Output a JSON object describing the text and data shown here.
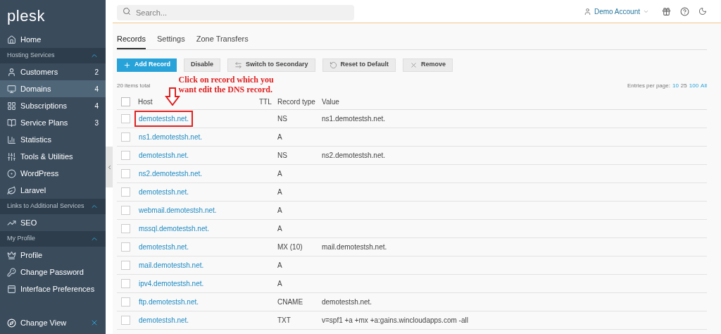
{
  "logo": "plesk",
  "sidebar": [
    {
      "kind": "item",
      "label": "Home",
      "selected": false
    },
    {
      "kind": "section",
      "label": "Hosting Services",
      "expanded": true
    },
    {
      "kind": "item",
      "label": "Customers",
      "count": "2",
      "selected": false
    },
    {
      "kind": "item",
      "label": "Domains",
      "count": "4",
      "selected": true
    },
    {
      "kind": "item",
      "label": "Subscriptions",
      "count": "4",
      "selected": false
    },
    {
      "kind": "item",
      "label": "Service Plans",
      "count": "3",
      "selected": false
    },
    {
      "kind": "item",
      "label": "Statistics",
      "selected": false
    },
    {
      "kind": "item",
      "label": "Tools & Utilities",
      "selected": false
    },
    {
      "kind": "item",
      "label": "WordPress",
      "selected": false
    },
    {
      "kind": "item",
      "label": "Laravel",
      "selected": false
    },
    {
      "kind": "section",
      "label": "Links to Additional Services",
      "expanded": true
    },
    {
      "kind": "item",
      "label": "SEO",
      "selected": false
    },
    {
      "kind": "section",
      "label": "My Profile",
      "expanded": true
    },
    {
      "kind": "item",
      "label": "Profile",
      "selected": false
    },
    {
      "kind": "item",
      "label": "Change Password",
      "selected": false
    },
    {
      "kind": "item",
      "label": "Interface Preferences",
      "selected": false
    }
  ],
  "change_view": {
    "label": "Change View"
  },
  "search": {
    "placeholder": "Search..."
  },
  "account": {
    "label": "Demo Account"
  },
  "tabs": [
    {
      "label": "Records",
      "selected": true
    },
    {
      "label": "Settings",
      "selected": false
    },
    {
      "label": "Zone Transfers",
      "selected": false
    }
  ],
  "toolbar": [
    {
      "kind": "primary",
      "label": "Add Record"
    },
    {
      "kind": "plain",
      "label": "Disable"
    },
    {
      "kind": "plain",
      "label": "Switch to Secondary"
    },
    {
      "kind": "plain",
      "label": "Reset to Default"
    },
    {
      "kind": "plain",
      "label": "Remove"
    }
  ],
  "items_total": "20 items total",
  "annotation": "Click on record which you want edit the DNS record.",
  "entries": {
    "label": "Entries per page:",
    "options": [
      {
        "label": "10",
        "selected": false
      },
      {
        "label": "25",
        "selected": true
      },
      {
        "label": "100",
        "selected": false
      },
      {
        "label": "All",
        "selected": false
      }
    ]
  },
  "table": {
    "select_all_checked": false,
    "columns": [
      "Host",
      "TTL",
      "Record type",
      "Value"
    ],
    "rows": [
      {
        "host": "demotestsh.net.",
        "type": "NS",
        "value": "ns1.demotestsh.net.",
        "checked": false,
        "highlighted": true
      },
      {
        "host": "ns1.demotestsh.net.",
        "type": "A",
        "checked": false,
        "highlighted": false
      },
      {
        "host": "demotestsh.net.",
        "type": "NS",
        "value": "ns2.demotestsh.net.",
        "checked": false,
        "highlighted": false
      },
      {
        "host": "ns2.demotestsh.net.",
        "type": "A",
        "checked": false,
        "highlighted": false
      },
      {
        "host": "demotestsh.net.",
        "type": "A",
        "checked": false,
        "highlighted": false
      },
      {
        "host": "webmail.demotestsh.net.",
        "type": "A",
        "checked": false,
        "highlighted": false
      },
      {
        "host": "mssql.demotestsh.net.",
        "type": "A",
        "checked": false,
        "highlighted": false
      },
      {
        "host": "demotestsh.net.",
        "type": "MX (10)",
        "value": "mail.demotestsh.net.",
        "checked": false,
        "highlighted": false
      },
      {
        "host": "mail.demotestsh.net.",
        "type": "A",
        "checked": false,
        "highlighted": false
      },
      {
        "host": "ipv4.demotestsh.net.",
        "type": "A",
        "checked": false,
        "highlighted": false
      },
      {
        "host": "ftp.demotestsh.net.",
        "type": "CNAME",
        "value": "demotestsh.net.",
        "checked": false,
        "highlighted": false
      },
      {
        "host": "demotestsh.net.",
        "type": "TXT",
        "value": "v=spf1 +a +mx +a:gains.wincloudapps.com -all",
        "checked": false,
        "highlighted": false
      }
    ]
  }
}
